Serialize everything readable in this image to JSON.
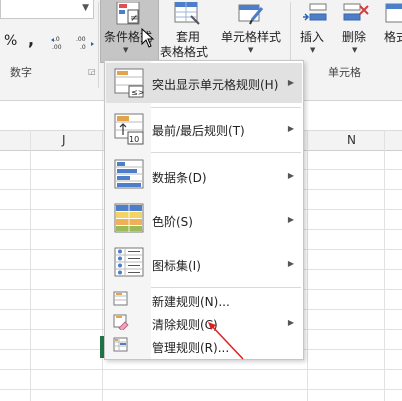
{
  "ribbon": {
    "number_format_value": "",
    "percent_symbol": "%",
    "comma_symbol": ",",
    "inc_decimal": "←.0 .00",
    "dec_decimal": ".00 →.0",
    "number_group_title": "数字",
    "cond_format_label": "条件格式",
    "format_table_label_1": "套用",
    "format_table_label_2": "表格格式",
    "cell_styles_label": "单元格样式",
    "insert_label": "插入",
    "delete_label": "删除",
    "format_label": "格式",
    "cells_group_title": "单元格"
  },
  "sheet": {
    "columns": [
      "J",
      "N"
    ]
  },
  "menu": {
    "items": [
      {
        "label": "突出显示单元格规则(H)",
        "icon": "highlight-cells-rules-icon",
        "submenu": true
      },
      {
        "label": "最前/最后规则(T)",
        "icon": "top-bottom-rules-icon",
        "submenu": true
      },
      {
        "label": "数据条(D)",
        "icon": "data-bars-icon",
        "submenu": true
      },
      {
        "label": "色阶(S)",
        "icon": "color-scales-icon",
        "submenu": true
      },
      {
        "label": "图标集(I)",
        "icon": "icon-sets-icon",
        "submenu": true
      },
      {
        "label": "新建规则(N)...",
        "icon": "new-rule-icon",
        "submenu": false
      },
      {
        "label": "清除规则(C)",
        "icon": "clear-rules-icon",
        "submenu": true
      },
      {
        "label": "管理规则(R)...",
        "icon": "manage-rules-icon",
        "submenu": false
      }
    ]
  },
  "colors": {
    "ribbon_bg": "#f3f3f3",
    "active_button": "#c5c5c5",
    "excel_green": "#217346",
    "annotation_red": "#e02020"
  }
}
